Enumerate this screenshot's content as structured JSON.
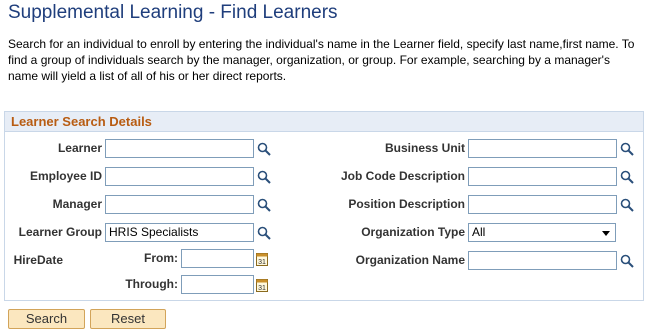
{
  "page": {
    "title": "Supplemental Learning - Find Learners",
    "description": "Search for an individual to enroll by entering the individual's name in the Learner field, specify last name,first name. To find a group of individuals search by the manager, organization, or group. For example, searching by a manager's name will yield a list of all of his or her direct reports."
  },
  "section": {
    "title": "Learner Search Details"
  },
  "left_fields": {
    "learner": {
      "label": "Learner",
      "value": ""
    },
    "employee_id": {
      "label": "Employee ID",
      "value": ""
    },
    "manager": {
      "label": "Manager",
      "value": ""
    },
    "learner_group": {
      "label": "Learner Group",
      "value": "HRIS Specialists"
    },
    "hire_date": {
      "label": "HireDate",
      "from_label": "From:",
      "from_value": "",
      "through_label": "Through:",
      "through_value": ""
    }
  },
  "right_fields": {
    "business_unit": {
      "label": "Business Unit",
      "value": ""
    },
    "job_code": {
      "label": "Job Code Description",
      "value": ""
    },
    "position": {
      "label": "Position Description",
      "value": ""
    },
    "org_type": {
      "label": "Organization Type",
      "value": "All"
    },
    "org_name": {
      "label": "Organization Name",
      "value": ""
    }
  },
  "buttons": {
    "search": "Search",
    "reset": "Reset"
  },
  "icons": {
    "lookup": "magnifier-icon",
    "calendar": "calendar-icon"
  }
}
